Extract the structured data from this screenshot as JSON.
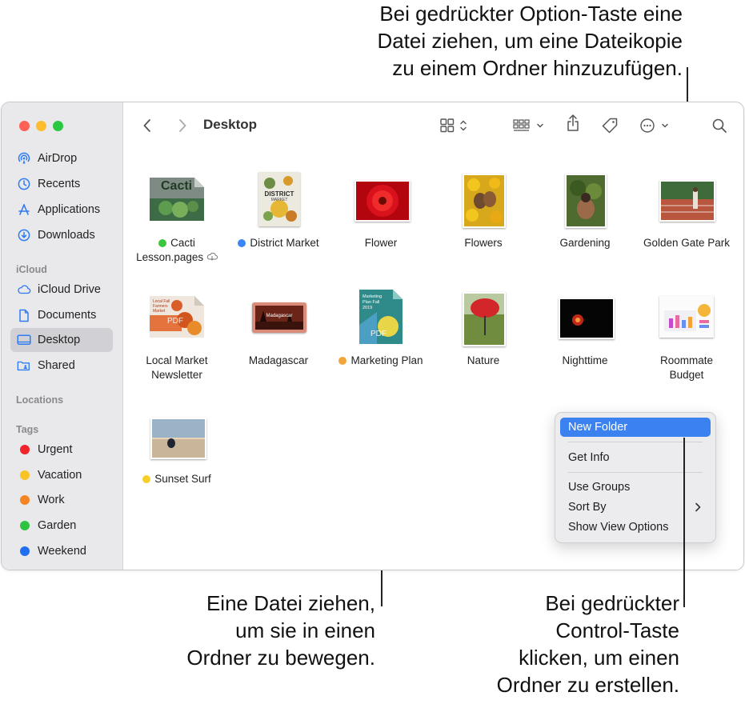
{
  "callouts": {
    "top": [
      "Bei gedrückter Option-Taste eine",
      "Datei ziehen, um eine Dateikopie",
      "zu einem Ordner hinzuzufügen."
    ],
    "bottom_left": [
      "Eine Datei ziehen,",
      "um sie in einen",
      "Ordner zu bewegen."
    ],
    "bottom_right": [
      "Bei gedrückter",
      "Control-Taste",
      "klicken, um einen",
      "Ordner zu erstellen."
    ]
  },
  "toolbar": {
    "title": "Desktop"
  },
  "sidebar": {
    "favorites": [
      {
        "label": "AirDrop",
        "icon": "airdrop-icon"
      },
      {
        "label": "Recents",
        "icon": "clock-icon"
      },
      {
        "label": "Applications",
        "icon": "applications-icon"
      },
      {
        "label": "Downloads",
        "icon": "download-icon"
      }
    ],
    "icloud_heading": "iCloud",
    "icloud": [
      {
        "label": "iCloud Drive",
        "icon": "cloud-icon"
      },
      {
        "label": "Documents",
        "icon": "document-icon"
      },
      {
        "label": "Desktop",
        "icon": "desktop-icon",
        "active": true
      },
      {
        "label": "Shared",
        "icon": "shared-folder-icon"
      }
    ],
    "locations_heading": "Locations",
    "tags_heading": "Tags",
    "tags": [
      {
        "label": "Urgent",
        "color": "#f0242a"
      },
      {
        "label": "Vacation",
        "color": "#f7c325"
      },
      {
        "label": "Work",
        "color": "#f68623"
      },
      {
        "label": "Garden",
        "color": "#2fc33f"
      },
      {
        "label": "Weekend",
        "color": "#1f6ff0"
      }
    ]
  },
  "files": [
    {
      "name1": "Cacti",
      "name2": "Lesson.pages",
      "dot": "#3ec53f",
      "cloud": true
    },
    {
      "name1": "District Market",
      "dot": "#3a87f4"
    },
    {
      "name1": "Flower"
    },
    {
      "name1": "Flowers"
    },
    {
      "name1": "Gardening"
    },
    {
      "name1": "Golden Gate Park"
    },
    {
      "name1": "Local Market",
      "name2": "Newsletter"
    },
    {
      "name1": "Madagascar"
    },
    {
      "name1": "Marketing Plan",
      "dot": "#f4a53a"
    },
    {
      "name1": "Nature"
    },
    {
      "name1": "Nighttime"
    },
    {
      "name1": "Roommate",
      "name2": "Budget"
    },
    {
      "name1": "Sunset Surf",
      "dot": "#f7cf2a"
    }
  ],
  "thumb_text": {
    "cacti": "Cacti",
    "district": "DISTRICT",
    "district_sub": "MARKET",
    "pdf": "PDF",
    "marketing": "Marketing Plan Fall 2019",
    "local": "Local Fall Farmers Market",
    "madagascar": "Madagascar"
  },
  "context_menu": {
    "items": [
      "New Folder",
      "Get Info",
      "Use Groups",
      "Sort By",
      "Show View Options"
    ]
  }
}
